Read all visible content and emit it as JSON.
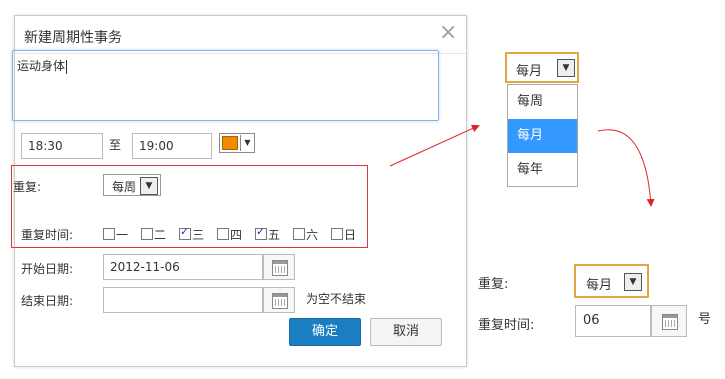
{
  "dialog": {
    "title": "新建周期性事务",
    "close_glyph": "×",
    "description_value": "运动身体",
    "start_time": "18:30",
    "to_label": "至",
    "end_time": "19:00",
    "event_color": "#f08a00",
    "repeat_label": "重复:",
    "repeat_value": "每周",
    "repeat_time_label": "重复时间:",
    "weekdays": [
      {
        "label": "一",
        "checked": false
      },
      {
        "label": "二",
        "checked": false
      },
      {
        "label": "三",
        "checked": true
      },
      {
        "label": "四",
        "checked": false
      },
      {
        "label": "五",
        "checked": true
      },
      {
        "label": "六",
        "checked": false
      },
      {
        "label": "日",
        "checked": false
      }
    ],
    "start_date_label": "开始日期:",
    "start_date": "2012-11-06",
    "end_date_label": "结束日期:",
    "end_date": "",
    "end_date_hint": "为空不结束",
    "ok_label": "确定",
    "cancel_label": "取消"
  },
  "dropdown_demo": {
    "selected": "每月",
    "options": [
      "每周",
      "每月",
      "每年"
    ],
    "highlighted_index": 1
  },
  "monthly_panel": {
    "repeat_label": "重复:",
    "repeat_value": "每月",
    "repeat_time_label": "重复时间:",
    "day_value": "06",
    "suffix": "号"
  },
  "colors": {
    "primary_button": "#1b7ec3",
    "highlight_box": "#d9363e",
    "arrow": "#e0242b",
    "select_focus_border": "#e0a640",
    "option_highlight": "#3399ff"
  }
}
